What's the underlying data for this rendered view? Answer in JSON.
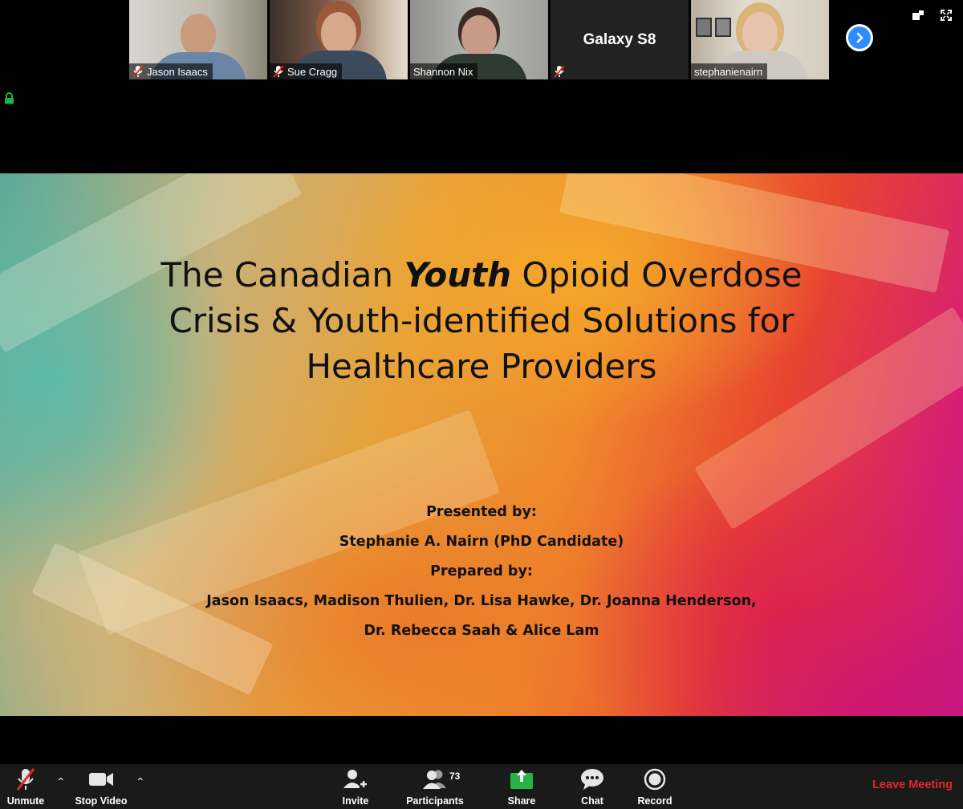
{
  "participants": [
    {
      "name": "Jason Isaacs",
      "muted": true,
      "video": true,
      "bg": "#c9c3b7",
      "skin": "#c99a7c",
      "shirt": "#6a86a6"
    },
    {
      "name": "Sue Cragg",
      "muted": true,
      "video": true,
      "bg": "#7b5a48",
      "skin": "#d7a88c",
      "shirt": "#3b4b5c"
    },
    {
      "name": "Shannon Nix",
      "muted": false,
      "video": true,
      "bg": "#a9aaa6",
      "skin": "#c99a86",
      "shirt": "#2f3a32"
    },
    {
      "name": "Galaxy S8",
      "muted": true,
      "video": false
    },
    {
      "name": "stephanienairn",
      "muted": false,
      "video": true,
      "active": true,
      "bg": "#d9d1c4",
      "skin": "#e7c3ad",
      "shirt": "#cfc9c2"
    }
  ],
  "slide": {
    "title_part1": "The Canadian ",
    "title_emph": "Youth",
    "title_part2": " Opioid Overdose",
    "title_line2": "Crisis & Youth-identified Solutions for",
    "title_line3": "Healthcare Providers",
    "presented_label": "Presented by:",
    "presenter": "Stephanie A. Nairn (PhD Candidate)",
    "prepared_label": "Prepared by:",
    "preparers_line1": "Jason Isaacs, Madison Thulien, Dr. Lisa Hawke, Dr. Joanna Henderson,",
    "preparers_line2": "Dr. Rebecca Saah & Alice Lam"
  },
  "toolbar": {
    "unmute": "Unmute",
    "stop_video": "Stop Video",
    "invite": "Invite",
    "participants": "Participants",
    "participant_count": "73",
    "share": "Share",
    "chat": "Chat",
    "record": "Record",
    "leave": "Leave Meeting"
  },
  "colors": {
    "active_speaker": "#8cc63f",
    "share_green": "#26b34a",
    "leave_red": "#e02828",
    "zoom_blue": "#2d8cff"
  }
}
